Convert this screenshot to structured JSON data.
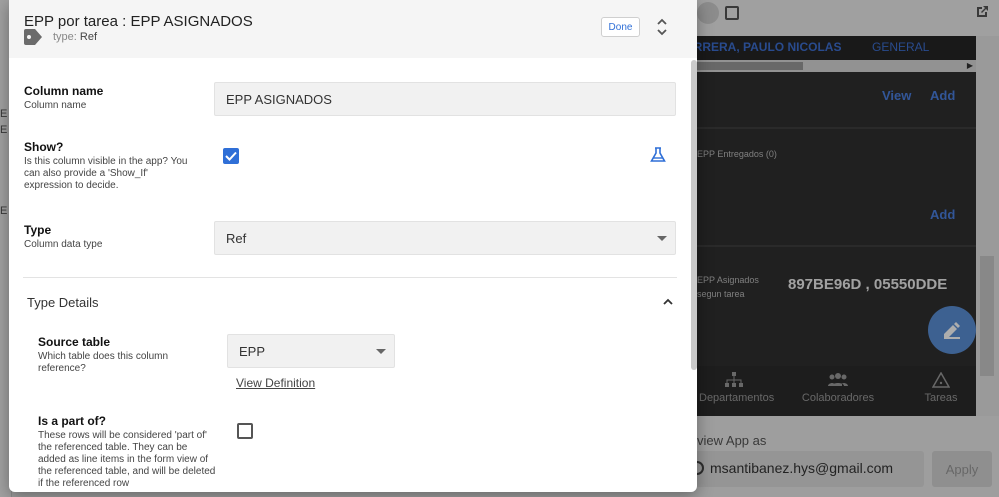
{
  "dialog": {
    "title": "EPP por tarea : EPP ASIGNADOS",
    "type_prefix": "type:",
    "type_value": "Ref",
    "done_label": "Done",
    "fields": {
      "column_name": {
        "label": "Column name",
        "help": "Column name",
        "value": "EPP ASIGNADOS"
      },
      "show": {
        "label": "Show?",
        "help": "Is this column visible in the app? You can also provide a 'Show_If' expression to decide.",
        "checked": true
      },
      "type": {
        "label": "Type",
        "help": "Column data type",
        "value": "Ref"
      }
    },
    "type_details": {
      "title": "Type Details",
      "source_table": {
        "label": "Source table",
        "help": "Which table does this column reference?",
        "value": "EPP",
        "link": "View Definition"
      },
      "is_part_of": {
        "label": "Is a part of?",
        "help": "These rows will be considered 'part of' the referenced table. They can be added as line items in the form view of the referenced table, and will be deleted if the referenced row",
        "checked": false
      }
    }
  },
  "background": {
    "preview": {
      "row_name": "ARRERA, PAULO NICOLAS",
      "row_category": "GENERAL",
      "view_label": "View",
      "add_label": "Add",
      "entregados_label": "EPP Entregados (0)",
      "add_label_2": "Add",
      "asignados_label_1": "EPP Asignados",
      "asignados_label_2": "segun tarea",
      "asignados_value": "897BE96D , 05550DDE"
    },
    "nav": [
      {
        "label": "Departamentos",
        "icon": "sitemap-icon"
      },
      {
        "label": "Colaboradores",
        "icon": "people-icon"
      },
      {
        "label": "Tareas",
        "icon": "warning-icon"
      }
    ],
    "preview_as_label": "view App as",
    "email": "msantibanez.hys@gmail.com",
    "apply_label": "Apply",
    "left_strip": [
      "E",
      "E",
      "E"
    ]
  },
  "colors": {
    "accent": "#2f6fd7",
    "preview_bg": "#303030",
    "fab": "#5b8fd6"
  }
}
